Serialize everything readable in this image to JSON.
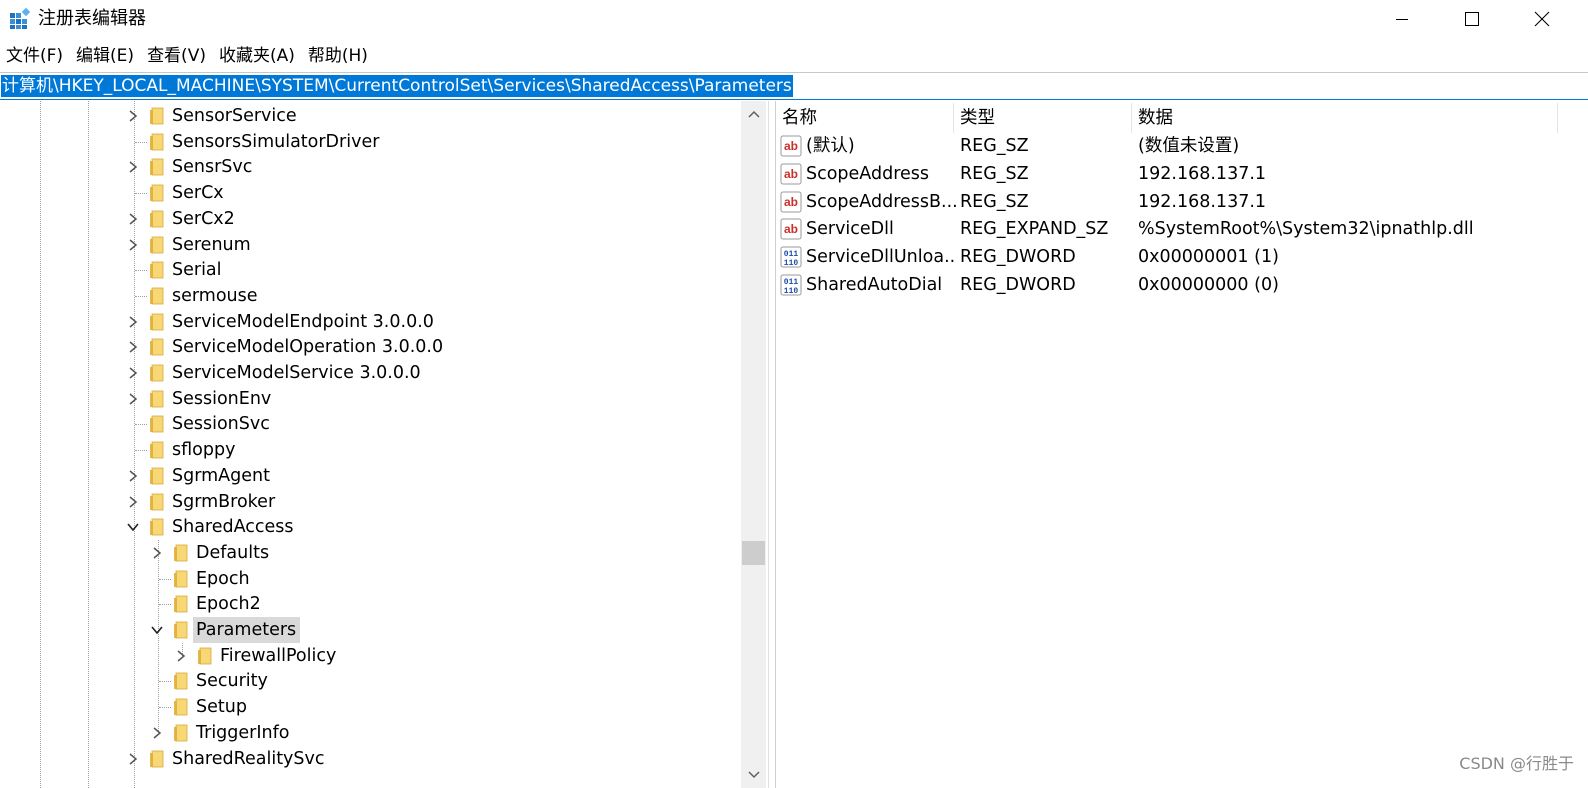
{
  "window": {
    "title": "注册表编辑器",
    "icon": "registry-editor-icon",
    "controls": [
      "minimize-icon",
      "maximize-icon",
      "close-icon"
    ]
  },
  "menu": [
    "文件(F)",
    "编辑(E)",
    "查看(V)",
    "收藏夹(A)",
    "帮助(H)"
  ],
  "address": "计算机\\HKEY_LOCAL_MACHINE\\SYSTEM\\CurrentControlSet\\Services\\SharedAccess\\Parameters",
  "tree": [
    {
      "label": "SensorService",
      "level": 0,
      "expander": "collapsed"
    },
    {
      "label": "SensorsSimulatorDriver",
      "level": 0,
      "expander": "none"
    },
    {
      "label": "SensrSvc",
      "level": 0,
      "expander": "collapsed"
    },
    {
      "label": "SerCx",
      "level": 0,
      "expander": "none"
    },
    {
      "label": "SerCx2",
      "level": 0,
      "expander": "collapsed"
    },
    {
      "label": "Serenum",
      "level": 0,
      "expander": "collapsed"
    },
    {
      "label": "Serial",
      "level": 0,
      "expander": "none"
    },
    {
      "label": "sermouse",
      "level": 0,
      "expander": "none"
    },
    {
      "label": "ServiceModelEndpoint 3.0.0.0",
      "level": 0,
      "expander": "collapsed"
    },
    {
      "label": "ServiceModelOperation 3.0.0.0",
      "level": 0,
      "expander": "collapsed"
    },
    {
      "label": "ServiceModelService 3.0.0.0",
      "level": 0,
      "expander": "collapsed"
    },
    {
      "label": "SessionEnv",
      "level": 0,
      "expander": "collapsed"
    },
    {
      "label": "SessionSvc",
      "level": 0,
      "expander": "none"
    },
    {
      "label": "sfloppy",
      "level": 0,
      "expander": "none"
    },
    {
      "label": "SgrmAgent",
      "level": 0,
      "expander": "collapsed"
    },
    {
      "label": "SgrmBroker",
      "level": 0,
      "expander": "collapsed"
    },
    {
      "label": "SharedAccess",
      "level": 0,
      "expander": "expanded"
    },
    {
      "label": "Defaults",
      "level": 1,
      "expander": "collapsed"
    },
    {
      "label": "Epoch",
      "level": 1,
      "expander": "none"
    },
    {
      "label": "Epoch2",
      "level": 1,
      "expander": "none"
    },
    {
      "label": "Parameters",
      "level": 1,
      "expander": "expanded",
      "selected": true
    },
    {
      "label": "FirewallPolicy",
      "level": 2,
      "expander": "collapsed"
    },
    {
      "label": "Security",
      "level": 1,
      "expander": "none"
    },
    {
      "label": "Setup",
      "level": 1,
      "expander": "none"
    },
    {
      "label": "TriggerInfo",
      "level": 1,
      "expander": "collapsed"
    },
    {
      "label": "SharedRealitySvc",
      "level": 0,
      "expander": "collapsed"
    }
  ],
  "list": {
    "columns": [
      "名称",
      "类型",
      "数据"
    ],
    "rows": [
      {
        "icon": "string-value-icon",
        "name": "(默认)",
        "type": "REG_SZ",
        "data": "(数值未设置)"
      },
      {
        "icon": "string-value-icon",
        "name": "ScopeAddress",
        "type": "REG_SZ",
        "data": "192.168.137.1"
      },
      {
        "icon": "string-value-icon",
        "name": "ScopeAddressB...",
        "type": "REG_SZ",
        "data": "192.168.137.1"
      },
      {
        "icon": "string-value-icon",
        "name": "ServiceDll",
        "type": "REG_EXPAND_SZ",
        "data": "%SystemRoot%\\System32\\ipnathlp.dll"
      },
      {
        "icon": "binary-value-icon",
        "name": "ServiceDllUnloa...",
        "type": "REG_DWORD",
        "data": "0x00000001 (1)"
      },
      {
        "icon": "binary-value-icon",
        "name": "SharedAutoDial",
        "type": "REG_DWORD",
        "data": "0x00000000 (0)"
      }
    ]
  },
  "watermark": "CSDN @行胜于",
  "colors": {
    "selection": "#0078d7",
    "folder": "#f8d775",
    "tree_selected": "#d9d9d9"
  }
}
